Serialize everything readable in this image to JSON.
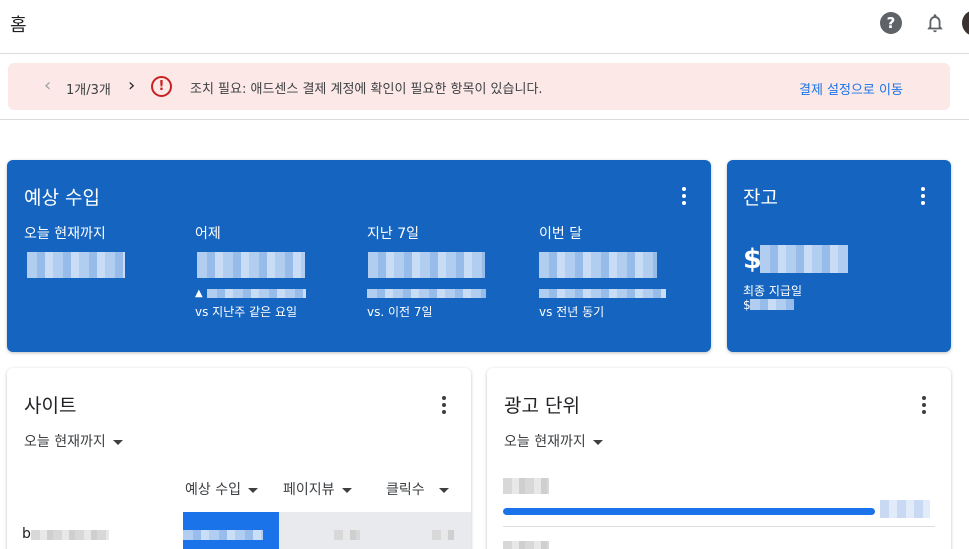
{
  "header": {
    "title": "홈",
    "help_glyph": "?"
  },
  "alert": {
    "counter": "1개/3개",
    "icon_glyph": "!",
    "message": "조치 필요: 애드센스 결제 계정에 확인이 필요한 항목이 있습니다.",
    "action": "결제 설정으로 이동",
    "prev_glyph": "‹",
    "next_glyph": "›"
  },
  "earnings": {
    "title": "예상 수입",
    "metrics": [
      {
        "label": "오늘 현재까지",
        "comparison": ""
      },
      {
        "label": "어제",
        "change_glyph": "▲",
        "comparison": "vs 지난주 같은 요일"
      },
      {
        "label": "지난 7일",
        "comparison": "vs. 이전 7일"
      },
      {
        "label": "이번 달",
        "comparison": "vs 전년 동기"
      }
    ]
  },
  "balance": {
    "title": "잔고",
    "currency": "$",
    "last_payment_label": "최종 지급일",
    "last_payment_currency": "$"
  },
  "sites": {
    "title": "사이트",
    "range": "오늘 현재까지",
    "columns": [
      "예상 수입",
      "페이지뷰",
      "클릭수"
    ],
    "row_prefix": "b"
  },
  "ad_units": {
    "title": "광고 단위",
    "range": "오늘 현재까지",
    "progress_fraction": 0.86
  },
  "colors": {
    "primary_blue": "#1565c0",
    "accent_blue": "#1a73e8",
    "alert_bg": "#fce8e6",
    "alert_red": "#c5221f"
  }
}
